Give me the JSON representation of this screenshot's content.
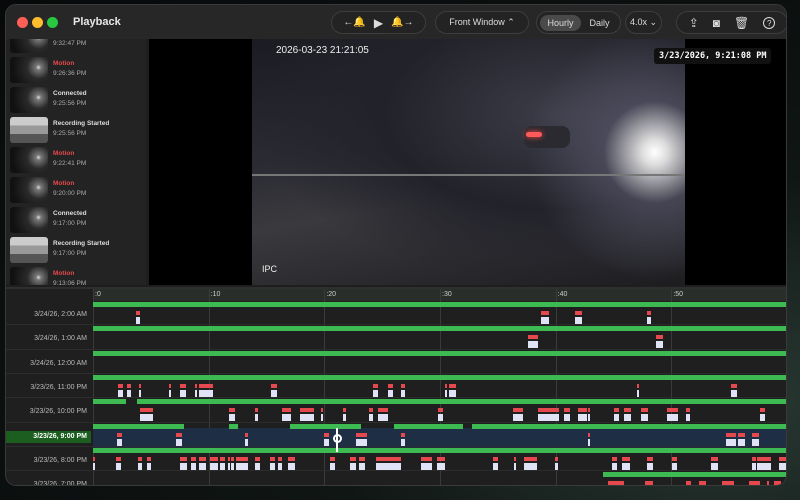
{
  "window": {
    "title": "Playback"
  },
  "toolbar": {
    "nav_prev_label": "←🔔",
    "play_label": "▶",
    "nav_next_label": "🔔→",
    "camera_select": "Front  Window ⌃",
    "hourly": "Hourly",
    "daily": "Daily",
    "speed": "4.0x ⌄",
    "share_icon": "share-icon",
    "snapshot_icon": "camera-icon",
    "delete_icon": "trash-icon",
    "help_icon": "help-icon"
  },
  "sidebar": {
    "events": [
      {
        "type": "",
        "time": "9:32:47 PM",
        "thumb": "cam"
      },
      {
        "type": "Motion",
        "time": "9:26:36 PM",
        "thumb": "cam"
      },
      {
        "type": "Connected",
        "time": "9:25:56 PM",
        "thumb": "cam"
      },
      {
        "type": "Recording Started",
        "time": "9:25:56 PM",
        "thumb": "rec"
      },
      {
        "type": "Motion",
        "time": "9:22:41 PM",
        "thumb": "cam"
      },
      {
        "type": "Motion",
        "time": "9:20:00 PM",
        "thumb": "cam"
      },
      {
        "type": "Connected",
        "time": "9:17:00 PM",
        "thumb": "cam"
      },
      {
        "type": "Recording Started",
        "time": "9:17:00 PM",
        "thumb": "rec"
      },
      {
        "type": "Motion",
        "time": "9:13:06 PM",
        "thumb": "cam"
      }
    ]
  },
  "video": {
    "camera_timestamp": "2026-03-23 21:21:05",
    "camera_label": "IPC",
    "overlay_time": "3/23/2026, 9:21:08 PM"
  },
  "timeline": {
    "ticks": [
      ":0",
      ":10",
      ":20",
      ":30",
      ":40",
      ":50"
    ],
    "playhead_minute": 21.1,
    "selected_row": 5,
    "rows": [
      {
        "label": "3/24/26, 2:00 AM",
        "recording": [
          [
            0,
            60
          ]
        ],
        "events": [
          [
            3.7,
            4.1
          ],
          [
            38.7,
            39.4
          ],
          [
            41.7,
            42.3
          ],
          [
            47.9,
            48.2
          ]
        ]
      },
      {
        "label": "3/24/26, 1:00 AM",
        "recording": [
          [
            0,
            60
          ]
        ],
        "events": [
          [
            37.6,
            38.5
          ],
          [
            48.7,
            49.3
          ]
        ]
      },
      {
        "label": "3/24/26, 12:00 AM",
        "recording": [
          [
            0,
            60
          ]
        ],
        "events": []
      },
      {
        "label": "3/23/26, 11:00 PM",
        "recording": [
          [
            0,
            60
          ]
        ],
        "events": [
          [
            2.2,
            2.6
          ],
          [
            2.9,
            3.3
          ],
          [
            4.0,
            4.1
          ],
          [
            6.6,
            6.7
          ],
          [
            7.5,
            8.0
          ],
          [
            8.8,
            8.9
          ],
          [
            9.2,
            10.4
          ],
          [
            15.4,
            15.9
          ],
          [
            24.2,
            24.6
          ],
          [
            25.5,
            25.9
          ],
          [
            26.6,
            27
          ],
          [
            30.4,
            30.5
          ],
          [
            30.8,
            31.4
          ],
          [
            47.0,
            47.1
          ],
          [
            55.2,
            55.7
          ]
        ]
      },
      {
        "label": "3/23/26, 10:00 PM",
        "recording": [
          [
            0,
            2.85
          ],
          [
            3.8,
            60
          ]
        ],
        "events": [
          [
            4.1,
            5.2
          ],
          [
            11.8,
            12.3
          ],
          [
            14,
            14.3
          ],
          [
            16.3,
            17.1
          ],
          [
            17.9,
            19.1
          ],
          [
            19.7,
            19.9
          ],
          [
            21.6,
            21.9
          ],
          [
            23.9,
            24.2
          ],
          [
            24.6,
            25.5
          ],
          [
            29.8,
            30.3
          ],
          [
            36.3,
            37.2
          ],
          [
            38.5,
            40.3
          ],
          [
            40.7,
            41.2
          ],
          [
            41.9,
            42.7
          ],
          [
            42.8,
            43
          ],
          [
            45,
            45.5
          ],
          [
            45.9,
            46.5
          ],
          [
            47.4,
            48
          ],
          [
            49.6,
            50.6
          ],
          [
            51.3,
            51.6
          ],
          [
            57.7,
            58.1
          ]
        ]
      },
      {
        "label": "3/23/26, 9:00 PM",
        "recording": [
          [
            0,
            7.9
          ],
          [
            11.8,
            12.5
          ],
          [
            17,
            23.2
          ],
          [
            26,
            32
          ],
          [
            32.8,
            60
          ]
        ],
        "events": [
          [
            2.1,
            2.5
          ],
          [
            7.2,
            7.7
          ],
          [
            13.1,
            13.4
          ],
          [
            20,
            20.4
          ],
          [
            22.7,
            23.7
          ],
          [
            26.6,
            27
          ],
          [
            42.8,
            43
          ],
          [
            54.7,
            55.6
          ],
          [
            55.8,
            56.4
          ],
          [
            57,
            57.6
          ]
        ]
      },
      {
        "label": "3/23/26, 8:00 PM",
        "recording": [
          [
            0,
            60
          ]
        ],
        "events": [
          [
            0,
            0.1
          ],
          [
            2,
            2.4
          ],
          [
            3.9,
            4.2
          ],
          [
            4.7,
            5
          ],
          [
            7.5,
            8.1
          ],
          [
            8.5,
            8.9
          ],
          [
            9.2,
            9.8
          ],
          [
            10.1,
            10.8
          ],
          [
            11,
            11.4
          ],
          [
            11.7,
            11.8
          ],
          [
            11.9,
            12.2
          ],
          [
            12.4,
            13.4
          ],
          [
            14,
            14.4
          ],
          [
            15.3,
            15.7
          ],
          [
            16,
            16.3
          ],
          [
            16.9,
            17.5
          ],
          [
            20.5,
            20.9
          ],
          [
            22.2,
            22.7
          ],
          [
            23,
            23.5
          ],
          [
            24.5,
            25.7
          ],
          [
            25.7,
            26.6
          ],
          [
            28.4,
            29.3
          ],
          [
            29.7,
            30.4
          ],
          [
            34.6,
            35
          ],
          [
            36.4,
            36.6
          ],
          [
            37.3,
            37.8
          ],
          [
            37.8,
            38.4
          ],
          [
            39.9,
            40.2
          ],
          [
            44.9,
            45.3
          ],
          [
            45.7,
            46.4
          ],
          [
            47.9,
            48.4
          ],
          [
            50.1,
            50.5
          ],
          [
            53.4,
            54
          ],
          [
            57,
            57.3
          ],
          [
            57.4,
            58.6
          ],
          [
            59.3,
            59.9
          ]
        ]
      },
      {
        "label": "3/23/26, 7:00 PM",
        "recording": [
          [
            44.1,
            60
          ]
        ],
        "events": [
          [
            44.5,
            45.9
          ],
          [
            47.7,
            48.4
          ],
          [
            51.3,
            51.7
          ],
          [
            52.4,
            53
          ],
          [
            54.4,
            55.4
          ],
          [
            56.7,
            57.7
          ],
          [
            58.3,
            58.4
          ],
          [
            58.9,
            59.5
          ]
        ]
      }
    ]
  },
  "colors": {
    "recording": "#3dbb52",
    "motion": "#e5484d",
    "clip": "#dfe3f5",
    "selected": "#1b5e1f"
  }
}
